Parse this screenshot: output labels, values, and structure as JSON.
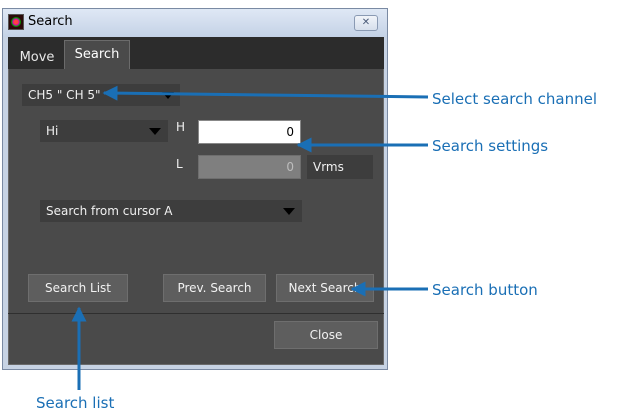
{
  "window": {
    "title": "Search",
    "close_glyph": "✕",
    "app_icon": "waveform-app-icon"
  },
  "tabs": [
    {
      "label": "Move",
      "active": false
    },
    {
      "label": "Search",
      "active": true
    }
  ],
  "search": {
    "channel": "CH5  \" CH 5\"",
    "level": "Hi",
    "h_label": "H",
    "l_label": "L",
    "h_value": "0",
    "l_value": "0",
    "unit": "Vrms",
    "from": "Search from cursor A"
  },
  "buttons": {
    "search_list": "Search List",
    "prev_search": "Prev. Search",
    "next_search": "Next Search",
    "close": "Close"
  },
  "annotations": {
    "channel": "Select search channel",
    "settings": "Search settings",
    "button": "Search button",
    "list": "Search list"
  },
  "colors": {
    "annotation": "#1a6fb5",
    "panel": "#4a4a4a",
    "control": "#3d3d3d"
  }
}
